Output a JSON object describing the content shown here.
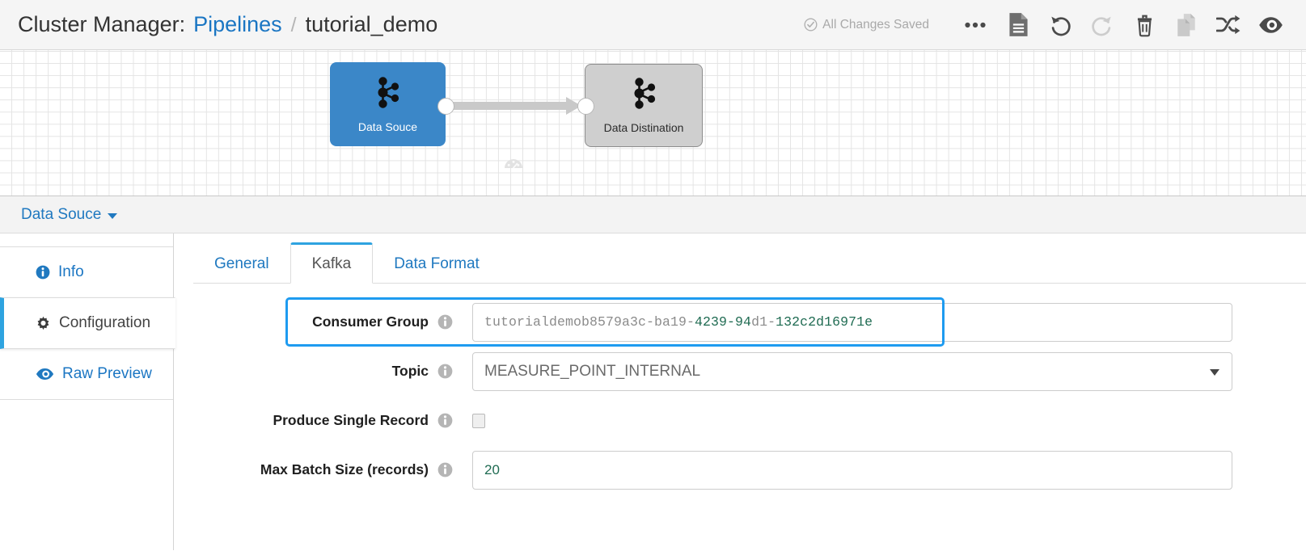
{
  "header": {
    "app_title": "Cluster Manager:",
    "breadcrumb_link": "Pipelines",
    "breadcrumb_separator": "/",
    "breadcrumb_current": "tutorial_demo",
    "save_status": "All Changes Saved",
    "save_status_icon": "check-circle-icon",
    "tools": [
      {
        "name": "more-options-icon",
        "label": "More Options",
        "enabled": true
      },
      {
        "name": "notes-icon",
        "label": "Notes",
        "enabled": true
      },
      {
        "name": "undo-icon",
        "label": "Undo",
        "enabled": true
      },
      {
        "name": "redo-icon",
        "label": "Redo",
        "enabled": false
      },
      {
        "name": "trash-icon",
        "label": "Delete",
        "enabled": true
      },
      {
        "name": "duplicate-icon",
        "label": "Duplicate",
        "enabled": false
      },
      {
        "name": "shuffle-icon",
        "label": "Auto Arrange",
        "enabled": true
      },
      {
        "name": "eye-icon",
        "label": "Preview",
        "enabled": true
      }
    ]
  },
  "canvas": {
    "nodes": [
      {
        "id": "source",
        "label": "Data Souce",
        "icon": "kafka-icon",
        "selected": true
      },
      {
        "id": "destination",
        "label": "Data Distination",
        "icon": "kafka-icon",
        "selected": false
      }
    ],
    "connection": {
      "from": "source",
      "to": "destination",
      "badge_icon": "gauge-icon"
    }
  },
  "subnav": {
    "selected_stage": "Data Souce",
    "caret_icon": "caret-down-icon"
  },
  "sidebar": {
    "items": [
      {
        "label": "Info",
        "icon": "info-circle-icon",
        "active": false
      },
      {
        "label": "Configuration",
        "icon": "gear-icon",
        "active": true
      },
      {
        "label": "Raw Preview",
        "icon": "eye-icon",
        "active": false
      }
    ]
  },
  "tabs": [
    {
      "label": "General",
      "active": false
    },
    {
      "label": "Kafka",
      "active": true
    },
    {
      "label": "Data Format",
      "active": false
    }
  ],
  "form": {
    "fields": [
      {
        "label": "Consumer Group",
        "info_icon": "info-icon",
        "type": "text",
        "value_prefix": "tutorialdemob8579a3c-ba19-",
        "value_mid": "4239-94",
        "value_mid2": "d1-",
        "value_suffix": "132c2d16971e",
        "value": "tutorialdemob8579a3c-ba19-4239-94d1-132c2d16971e",
        "highlighted": true
      },
      {
        "label": "Topic",
        "info_icon": "info-icon",
        "type": "select",
        "value": "MEASURE_POINT_INTERNAL",
        "caret_icon": "caret-down-icon"
      },
      {
        "label": "Produce Single Record",
        "info_icon": "info-icon",
        "type": "checkbox",
        "checked": false
      },
      {
        "label": "Max Batch Size (records)",
        "info_icon": "info-icon",
        "type": "number",
        "value": "20"
      }
    ]
  },
  "colors": {
    "link_blue": "#2079c0",
    "accent_blue": "#2ea3e0",
    "node_selected": "#3b87c8",
    "node_default": "#cfcfcf",
    "highlight_border": "#1e9bf0",
    "value_green": "#1f6b52"
  }
}
